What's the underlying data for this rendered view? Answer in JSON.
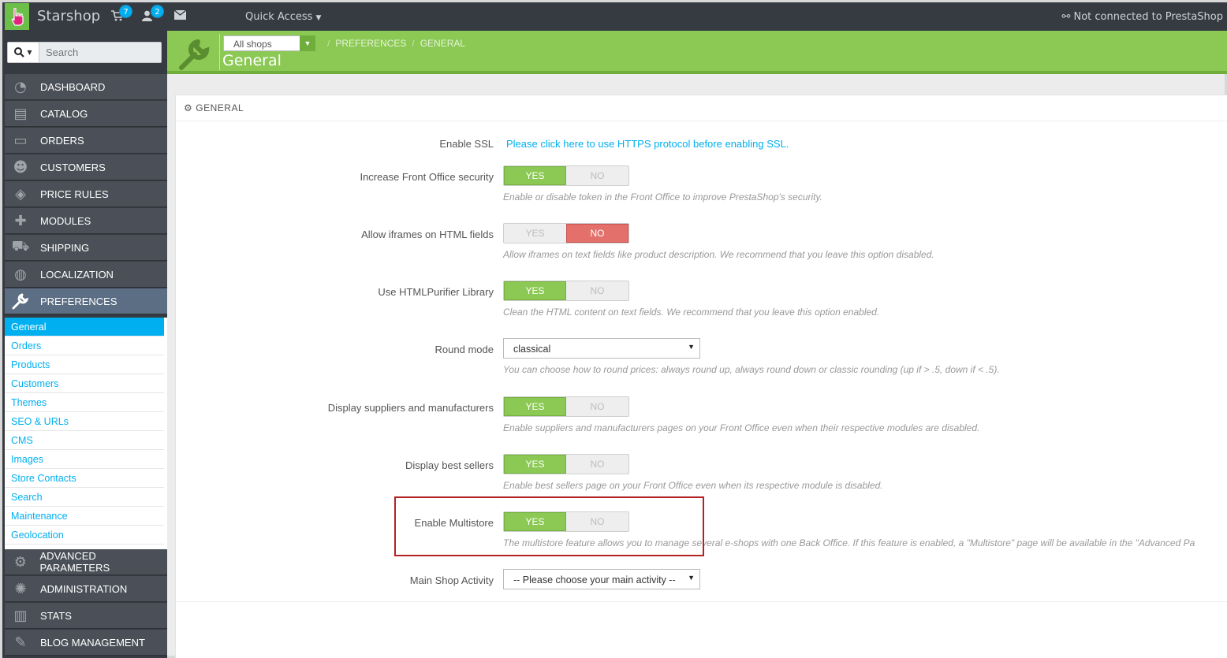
{
  "topbar": {
    "brand": "Starshop",
    "cart_badge": "7",
    "customers_badge": "2",
    "quick_access": "Quick Access",
    "connection_status": "Not connected to PrestaShop"
  },
  "sidebar": {
    "search_placeholder": "Search",
    "menu": [
      {
        "label": "DASHBOARD",
        "icon": "dashboard-icon"
      },
      {
        "label": "CATALOG",
        "icon": "book-icon"
      },
      {
        "label": "ORDERS",
        "icon": "credit-card-icon"
      },
      {
        "label": "CUSTOMERS",
        "icon": "users-icon"
      },
      {
        "label": "PRICE RULES",
        "icon": "tags-icon"
      },
      {
        "label": "MODULES",
        "icon": "puzzle-icon"
      },
      {
        "label": "SHIPPING",
        "icon": "truck-icon"
      },
      {
        "label": "LOCALIZATION",
        "icon": "globe-icon"
      },
      {
        "label": "PREFERENCES",
        "icon": "wrench-icon"
      }
    ],
    "submenu": [
      "General",
      "Orders",
      "Products",
      "Customers",
      "Themes",
      "SEO & URLs",
      "CMS",
      "Images",
      "Store Contacts",
      "Search",
      "Maintenance",
      "Geolocation"
    ],
    "menu_bottom": [
      {
        "label": "ADVANCED PARAMETERS",
        "icon": "cogs-icon"
      },
      {
        "label": "ADMINISTRATION",
        "icon": "gear-icon"
      },
      {
        "label": "STATS",
        "icon": "bar-chart-icon"
      },
      {
        "label": "BLOG MANAGEMENT",
        "icon": "pencil-icon"
      }
    ]
  },
  "header": {
    "shop_select": "All shops",
    "breadcrumb": [
      "PREFERENCES",
      "GENERAL"
    ],
    "title": "General"
  },
  "panel": {
    "heading": "GENERAL",
    "ssl_label": "Enable SSL",
    "ssl_link": "Please click here to use HTTPS protocol before enabling SSL.",
    "yes": "YES",
    "no": "NO",
    "rows": [
      {
        "label": "Increase Front Office security",
        "value": "YES",
        "help": "Enable or disable token in the Front Office to improve PrestaShop's security."
      },
      {
        "label": "Allow iframes on HTML fields",
        "value": "NO",
        "help": "Allow iframes on text fields like product description. We recommend that you leave this option disabled."
      },
      {
        "label": "Use HTMLPurifier Library",
        "value": "YES",
        "help": "Clean the HTML content on text fields. We recommend that you leave this option enabled."
      },
      {
        "label": "Display suppliers and manufacturers",
        "value": "YES",
        "help": "Enable suppliers and manufacturers pages on your Front Office even when their respective modules are disabled."
      },
      {
        "label": "Display best sellers",
        "value": "YES",
        "help": "Enable best sellers page on your Front Office even when its respective module is disabled."
      },
      {
        "label": "Enable Multistore",
        "value": "YES",
        "help": "The multistore feature allows you to manage several e-shops with one Back Office. If this feature is enabled, a \"Multistore\" page will be available in the \"Advanced Pa"
      }
    ],
    "round_mode": {
      "label": "Round mode",
      "value": "classical",
      "help": "You can choose how to round prices: always round up, always round down or classic rounding (up if > .5, down if < .5)."
    },
    "main_activity": {
      "label": "Main Shop Activity",
      "value": "-- Please choose your main activity --"
    }
  }
}
